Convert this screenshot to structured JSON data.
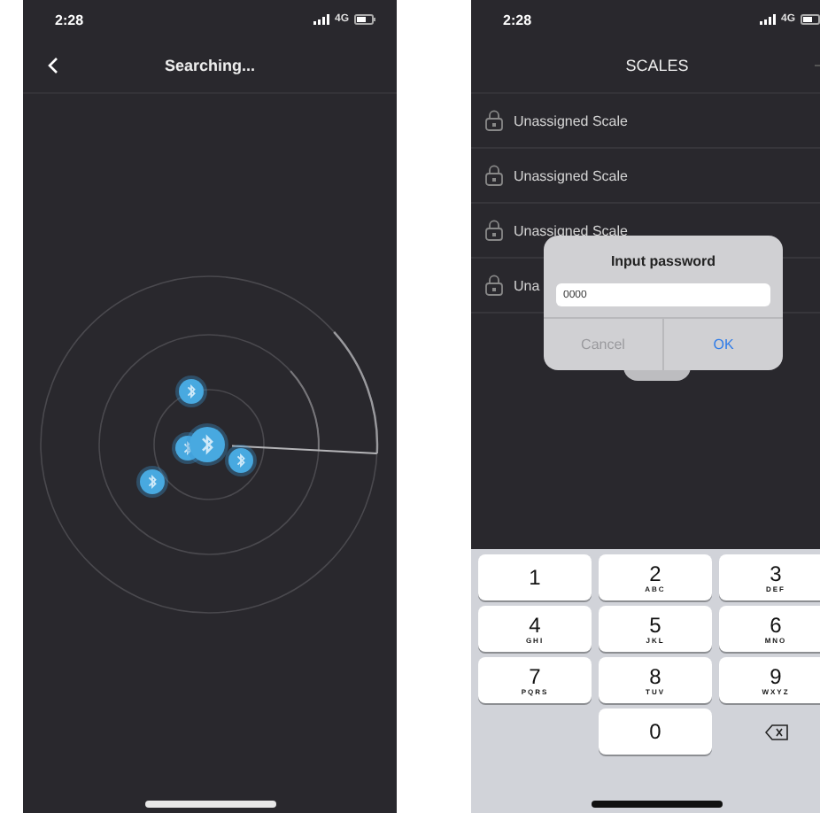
{
  "left_screen": {
    "status_bar": {
      "time": "2:28",
      "network": "4G"
    },
    "nav": {
      "title": "Searching..."
    }
  },
  "right_screen": {
    "status_bar": {
      "time": "2:28",
      "network": "4G"
    },
    "nav": {
      "title": "SCALES"
    },
    "scales": [
      {
        "name": "Unassigned Scale"
      },
      {
        "name": "Unassigned Scale"
      },
      {
        "name": "Unassigned Scale"
      },
      {
        "name": "Una"
      }
    ],
    "dialog": {
      "title": "Input password",
      "value": "0000",
      "buttons": [
        "Cancel",
        "OK"
      ]
    },
    "keypad": [
      {
        "kind": "digit",
        "digit": "1"
      },
      {
        "kind": "digit",
        "digit": "2",
        "letters": "ABC"
      },
      {
        "kind": "digit",
        "digit": "3",
        "letters": "DEF"
      },
      {
        "kind": "digit",
        "digit": "4",
        "letters": "GHI"
      },
      {
        "kind": "digit",
        "digit": "5",
        "letters": "JKL"
      },
      {
        "kind": "digit",
        "digit": "6",
        "letters": "MNO"
      },
      {
        "kind": "digit",
        "digit": "7",
        "letters": "PQRS"
      },
      {
        "kind": "digit",
        "digit": "8",
        "letters": "TUV"
      },
      {
        "kind": "digit",
        "digit": "9",
        "letters": "WXYZ"
      },
      {
        "kind": "blank"
      },
      {
        "kind": "digit",
        "digit": "0"
      },
      {
        "kind": "delete"
      }
    ]
  }
}
